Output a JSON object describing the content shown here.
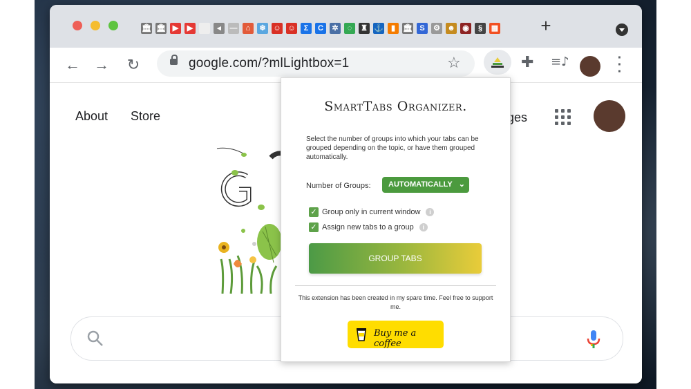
{
  "browser": {
    "tabs": [
      {
        "name": "tab-favicon-1",
        "glyph": "🏛",
        "bg": "#777777"
      },
      {
        "name": "tab-favicon-2",
        "glyph": "🏛",
        "bg": "#777777"
      },
      {
        "name": "tab-favicon-3",
        "glyph": "▶",
        "bg": "#e53935"
      },
      {
        "name": "tab-favicon-4",
        "glyph": "▶",
        "bg": "#e53935"
      },
      {
        "name": "tab-favicon-5",
        "glyph": "",
        "bg": "#eeeeee"
      },
      {
        "name": "tab-favicon-6",
        "glyph": "◂",
        "bg": "#888888"
      },
      {
        "name": "tab-favicon-7",
        "glyph": "—",
        "bg": "#bbbbbb"
      },
      {
        "name": "tab-favicon-8",
        "glyph": "⌂",
        "bg": "#e25b3a"
      },
      {
        "name": "tab-favicon-9",
        "glyph": "❄",
        "bg": "#5aa7e0"
      },
      {
        "name": "tab-favicon-10",
        "glyph": "☺",
        "bg": "#d93025"
      },
      {
        "name": "tab-favicon-11",
        "glyph": "☺",
        "bg": "#d93025"
      },
      {
        "name": "tab-favicon-12",
        "glyph": "Σ",
        "bg": "#1a73e8"
      },
      {
        "name": "tab-favicon-13",
        "glyph": "C",
        "bg": "#1a73e8"
      },
      {
        "name": "tab-favicon-14",
        "glyph": "✲",
        "bg": "#4a6fa5"
      },
      {
        "name": "tab-favicon-15",
        "glyph": "◌",
        "bg": "#34a853"
      },
      {
        "name": "tab-favicon-16",
        "glyph": "♜",
        "bg": "#333333"
      },
      {
        "name": "tab-favicon-17",
        "glyph": "⚓",
        "bg": "#1565c0"
      },
      {
        "name": "tab-favicon-18",
        "glyph": "▮",
        "bg": "#f57c00"
      },
      {
        "name": "tab-favicon-19",
        "glyph": "🏛",
        "bg": "#777777"
      },
      {
        "name": "tab-favicon-20",
        "glyph": "S",
        "bg": "#3367d6"
      },
      {
        "name": "tab-favicon-21",
        "glyph": "⚙",
        "bg": "#999999"
      },
      {
        "name": "tab-favicon-22",
        "glyph": "☻",
        "bg": "#c58b1f"
      },
      {
        "name": "tab-favicon-23",
        "glyph": "◉",
        "bg": "#8e2424"
      },
      {
        "name": "tab-favicon-24",
        "glyph": "§",
        "bg": "#444444"
      },
      {
        "name": "tab-favicon-25",
        "glyph": "▦",
        "bg": "#f25022"
      }
    ],
    "new_tab": "+",
    "url": "google.com/?mlLightbox=1"
  },
  "google": {
    "about": "About",
    "store": "Store",
    "images_fragment": "ges"
  },
  "popup": {
    "title": "SmartTabs Organizer.",
    "description": "Select the number of groups into which your tabs can be grouped depending on the topic, or have them grouped automatically.",
    "groups_label": "Number of Groups:",
    "groups_value": "AUTOMATICALLY",
    "option_current_window": "Group only in current window",
    "option_assign_new": "Assign new tabs to a group",
    "group_button": "GROUP TABS",
    "footer": "This extension has been created in my spare time. Feel free to support me.",
    "coffee_button": "Buy me a coffee"
  },
  "colors": {
    "accent_green": "#4b9a3e",
    "coffee_yellow": "#ffdd00"
  }
}
